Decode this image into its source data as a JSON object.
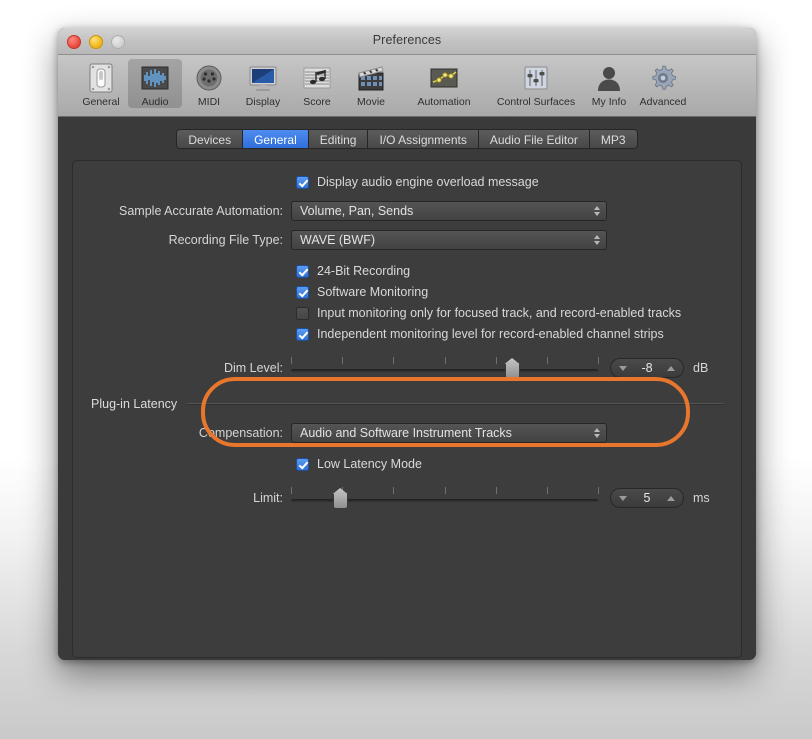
{
  "window": {
    "title": "Preferences",
    "traffic_lights": [
      "close-button",
      "minimize-button",
      "zoom-button"
    ]
  },
  "toolbar": {
    "items": [
      {
        "label": "General",
        "icon": "switch-icon",
        "selected": false
      },
      {
        "label": "Audio",
        "icon": "waveform-icon",
        "selected": true
      },
      {
        "label": "MIDI",
        "icon": "midi-port-icon",
        "selected": false
      },
      {
        "label": "Display",
        "icon": "monitor-icon",
        "selected": false
      },
      {
        "label": "Score",
        "icon": "music-notes-icon",
        "selected": false
      },
      {
        "label": "Movie",
        "icon": "clapperboard-icon",
        "selected": false
      },
      {
        "label": "Automation",
        "icon": "node-graph-icon",
        "selected": false
      },
      {
        "label": "Control Surfaces",
        "icon": "faders-icon",
        "selected": false
      },
      {
        "label": "My Info",
        "icon": "person-icon",
        "selected": false
      },
      {
        "label": "Advanced",
        "icon": "gear-icon",
        "selected": false
      }
    ]
  },
  "tabs": [
    {
      "label": "Devices",
      "active": false
    },
    {
      "label": "General",
      "active": true
    },
    {
      "label": "Editing",
      "active": false
    },
    {
      "label": "I/O Assignments",
      "active": false
    },
    {
      "label": "Audio File Editor",
      "active": false
    },
    {
      "label": "MP3",
      "active": false
    }
  ],
  "general_pane": {
    "overload_checkbox": {
      "label": "Display audio engine overload message",
      "checked": true
    },
    "sample_accurate_automation": {
      "label": "Sample Accurate Automation:",
      "value": "Volume, Pan, Sends"
    },
    "recording_file_type": {
      "label": "Recording File Type:",
      "value": "WAVE (BWF)"
    },
    "checkboxes": [
      {
        "label": "24-Bit Recording",
        "checked": true
      },
      {
        "label": "Software Monitoring",
        "checked": true
      },
      {
        "label": "Input monitoring only for focused track, and record-enabled tracks",
        "checked": false
      },
      {
        "label": "Independent monitoring level for record-enabled channel strips",
        "checked": true
      }
    ],
    "dim_level": {
      "label": "Dim Level:",
      "value": "-8",
      "unit": "dB",
      "thumb_percent": 72,
      "tick_count": 7
    }
  },
  "plugin_latency": {
    "section_title": "Plug-in Latency",
    "compensation": {
      "label": "Compensation:",
      "value": "Audio and Software Instrument Tracks"
    },
    "low_latency_mode": {
      "label": "Low Latency Mode",
      "checked": true
    },
    "limit": {
      "label": "Limit:",
      "value": "5",
      "unit": "ms",
      "thumb_percent": 16,
      "tick_count": 7
    },
    "highlight_color": "#e8762c"
  }
}
